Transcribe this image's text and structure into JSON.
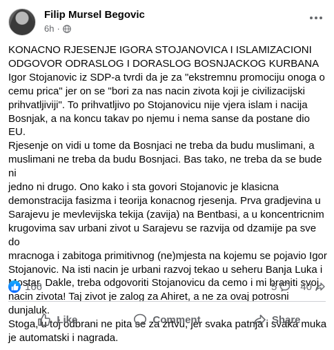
{
  "post": {
    "author": "Filip Mursel Begovic",
    "time": "6h",
    "privacy_icon": "globe-icon",
    "text": "KONACNO RJESENJE IGORA STOJANOVICA I ISLAMIZACIONI\nODGOVOR ODRASLOG I DORASLOG BOSNJACKOG KURBANA\nIgor Stojanovic iz SDP-a tvrdi da je za \"ekstremnu promociju onoga o\ncemu prica\" jer on se \"bori za nas nacin zivota koji je civilizacijski\nprihvatljiviji\". To prihvatljivo po Stojanovicu nije vjera islam i nacija\nBosnjak, a na koncu takav po njemu i nema sanse da postane dio EU.\nRjesenje on vidi u tome da Bosnjaci ne treba da budu muslimani, a\nmuslimani ne treba da budu Bosnjaci. Bas tako, ne treba da se bude ni\njedno ni drugo. Ono kako i sta govori Stojanovic je klasicna\ndemonstracija fasizma i teorija konacnog rjesenja. Prva gradjevina u\nSarajevu je mevlevijska tekija (zavija) na Bentbasi, a u koncentricnim\nkrugovima sav urbani zivot u Sarajevu se razvija od dzamije pa sve do\nmracnoga i zabitoga primitivnog (ne)mjesta na kojemu se pojavio Igor\nStojanovic. Na isti nacin je urbani razvoj tekao u seheru Banja Luka i\nMostar. Dakle, treba odgovoriti Stojanovicu da cemo i mi braniti svoj\nnacin zivota! Taj zivot je zalog za Ahiret, a ne za ovaj potrosni dunjaluk.\nStoga, u toj odbrani ne pita se za zrtvu, jer svaka patnja i svaka muka\nje automatski i nagrada."
  },
  "stats": {
    "reaction_count": "166",
    "comment_count": "5",
    "share_count": "40"
  },
  "actions": {
    "like": "Like",
    "comment": "Comment",
    "share": "Share"
  },
  "colors": {
    "accent": "#0866ff",
    "secondary_text": "#65676b",
    "divider": "#ced0d4"
  }
}
